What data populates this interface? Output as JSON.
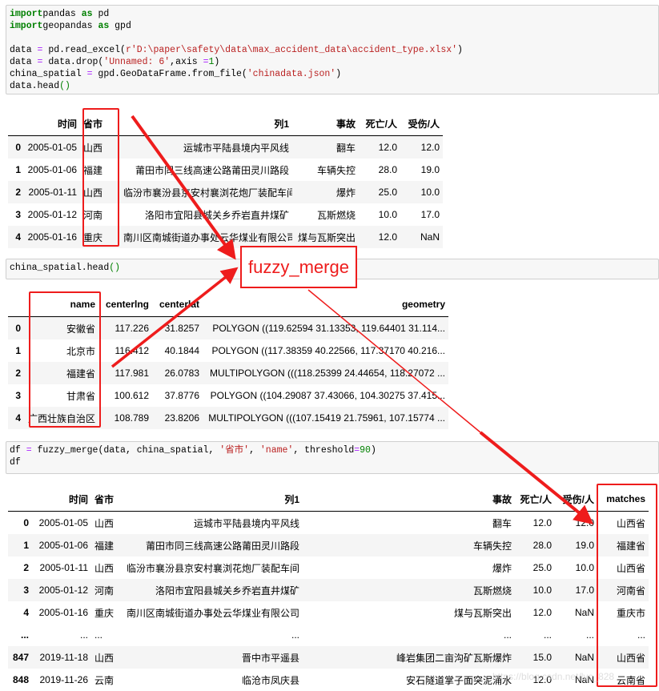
{
  "cells": {
    "cell1_code": [
      [
        [
          "kw",
          "import"
        ],
        [
          "",
          "pandas "
        ],
        [
          "kw",
          "as"
        ],
        [
          "",
          " pd"
        ]
      ],
      [
        [
          "kw",
          "import"
        ],
        [
          "",
          "geopandas "
        ],
        [
          "kw",
          "as"
        ],
        [
          "",
          " gpd"
        ]
      ],
      [],
      [
        [
          "",
          "data "
        ],
        [
          "op",
          "="
        ],
        [
          "",
          " pd.read_excel("
        ],
        [
          "str",
          "r'D:\\paper\\safety\\data\\max_accident_data\\accident_type.xlsx'"
        ],
        [
          "",
          ")"
        ]
      ],
      [
        [
          "",
          "data "
        ],
        [
          "op",
          "="
        ],
        [
          "",
          " data.drop("
        ],
        [
          "str",
          "'Unnamed: 6'"
        ],
        [
          "",
          ",axis "
        ],
        [
          "op",
          "="
        ],
        [
          "num",
          "1"
        ],
        [
          "",
          ")"
        ]
      ],
      [
        [
          "",
          "china_spatial "
        ],
        [
          "op",
          "="
        ],
        [
          "",
          " gpd.GeoDataFrame.from_file("
        ],
        [
          "str",
          "'chinadata.json'"
        ],
        [
          "",
          ")"
        ]
      ],
      [
        [
          "",
          "data.head"
        ],
        [
          "num",
          "()"
        ]
      ]
    ],
    "cell2_code": [
      [
        [
          "",
          "china_spatial.head"
        ],
        [
          "num",
          "()"
        ]
      ]
    ],
    "cell3_code": [
      [
        [
          "",
          "df "
        ],
        [
          "op",
          "="
        ],
        [
          "",
          " fuzzy_merge(data, china_spatial, "
        ],
        [
          "str",
          "'省市'"
        ],
        [
          "",
          ", "
        ],
        [
          "str",
          "'name'"
        ],
        [
          "",
          ", threshold"
        ],
        [
          "op",
          "="
        ],
        [
          "num",
          "90"
        ],
        [
          "",
          ")"
        ]
      ],
      [
        [
          "",
          "df"
        ]
      ]
    ]
  },
  "table1": {
    "columns": [
      "",
      "时间",
      "省市",
      "列1",
      "事故",
      "死亡/人",
      "受伤/人"
    ],
    "rows": [
      [
        "0",
        "2005-01-05",
        "山西",
        "运城市平陆县境内平风线",
        "翻车",
        "12.0",
        "12.0"
      ],
      [
        "1",
        "2005-01-06",
        "福建",
        "莆田市同三线高速公路莆田灵川路段",
        "车辆失控",
        "28.0",
        "19.0"
      ],
      [
        "2",
        "2005-01-11",
        "山西",
        "临汾市襄汾县京安村襄浏花炮厂装配车间",
        "爆炸",
        "25.0",
        "10.0"
      ],
      [
        "3",
        "2005-01-12",
        "河南",
        "洛阳市宜阳县城关乡乔岩直井煤矿",
        "瓦斯燃烧",
        "10.0",
        "17.0"
      ],
      [
        "4",
        "2005-01-16",
        "重庆",
        "南川区南城街道办事处云华煤业有限公司",
        "煤与瓦斯突出",
        "12.0",
        "NaN"
      ]
    ]
  },
  "table2": {
    "columns": [
      "",
      "name",
      "centerlng",
      "centerlat",
      "geometry"
    ],
    "rows": [
      [
        "0",
        "安徽省",
        "117.226",
        "31.8257",
        "POLYGON ((119.62594 31.13353, 119.64401 31.114..."
      ],
      [
        "1",
        "北京市",
        "116.412",
        "40.1844",
        "POLYGON ((117.38359 40.22566, 117.37170 40.216..."
      ],
      [
        "2",
        "福建省",
        "117.981",
        "26.0783",
        "MULTIPOLYGON (((118.25399 24.44654, 118.27072 ..."
      ],
      [
        "3",
        "甘肃省",
        "100.612",
        "37.8776",
        "POLYGON ((104.29087 37.43066, 104.30275 37.415..."
      ],
      [
        "4",
        "广西壮族自治区",
        "108.789",
        "23.8206",
        "MULTIPOLYGON (((107.15419 21.75961, 107.15774 ..."
      ]
    ]
  },
  "table3": {
    "columns": [
      "",
      "时间",
      "省市",
      "列1",
      "事故",
      "死亡/人",
      "受伤/人",
      "matches"
    ],
    "rows": [
      [
        "0",
        "2005-01-05",
        "山西",
        "运城市平陆县境内平风线",
        "翻车",
        "12.0",
        "12.0",
        "山西省"
      ],
      [
        "1",
        "2005-01-06",
        "福建",
        "莆田市同三线高速公路莆田灵川路段",
        "车辆失控",
        "28.0",
        "19.0",
        "福建省"
      ],
      [
        "2",
        "2005-01-11",
        "山西",
        "临汾市襄汾县京安村襄浏花炮厂装配车间",
        "爆炸",
        "25.0",
        "10.0",
        "山西省"
      ],
      [
        "3",
        "2005-01-12",
        "河南",
        "洛阳市宜阳县城关乡乔岩直井煤矿",
        "瓦斯燃烧",
        "10.0",
        "17.0",
        "河南省"
      ],
      [
        "4",
        "2005-01-16",
        "重庆",
        "南川区南城街道办事处云华煤业有限公司",
        "煤与瓦斯突出",
        "12.0",
        "NaN",
        "重庆市"
      ],
      [
        "...",
        "...",
        "...",
        "...",
        "...",
        "...",
        "...",
        "..."
      ],
      [
        "847",
        "2019-11-18",
        "山西",
        "晋中市平遥县",
        "峰岩集团二亩沟矿瓦斯爆炸",
        "15.0",
        "NaN",
        "山西省"
      ],
      [
        "848",
        "2019-11-26",
        "云南",
        "临沧市凤庆县",
        "安石隧道掌子面突泥涌水",
        "12.0",
        "NaN",
        "云南省"
      ]
    ]
  },
  "annotation": {
    "label": "fuzzy_merge",
    "color": "#ee1c1c"
  },
  "watermark": "https://blog.csdn.net/lyc_828"
}
